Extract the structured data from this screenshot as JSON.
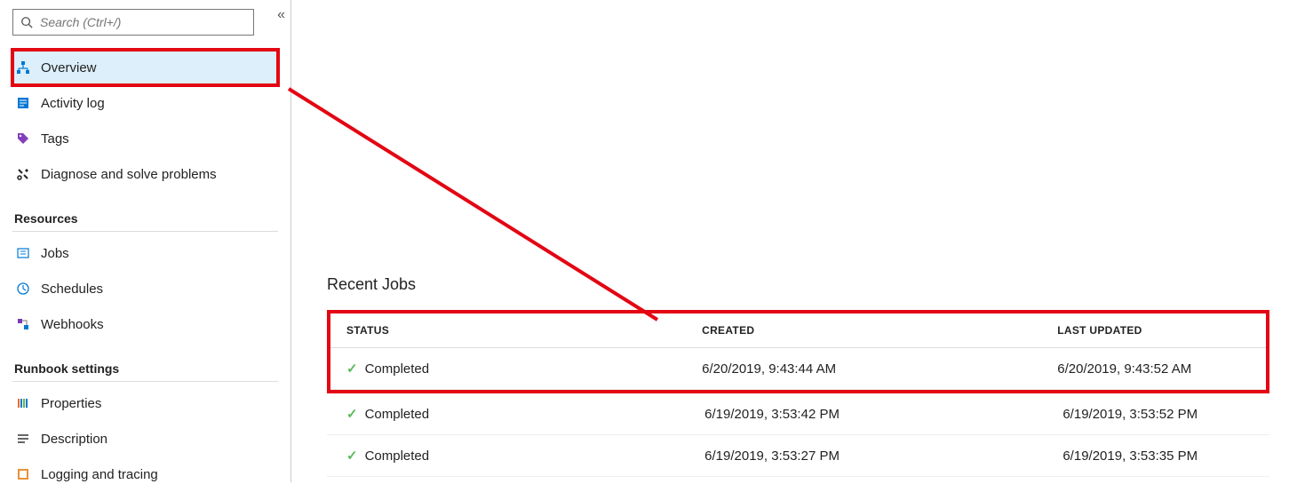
{
  "search": {
    "placeholder": "Search (Ctrl+/)"
  },
  "nav": {
    "items": [
      {
        "label": "Overview"
      },
      {
        "label": "Activity log"
      },
      {
        "label": "Tags"
      },
      {
        "label": "Diagnose and solve problems"
      }
    ],
    "resources_title": "Resources",
    "resources": [
      {
        "label": "Jobs"
      },
      {
        "label": "Schedules"
      },
      {
        "label": "Webhooks"
      }
    ],
    "runbook_title": "Runbook settings",
    "runbook": [
      {
        "label": "Properties"
      },
      {
        "label": "Description"
      },
      {
        "label": "Logging and tracing"
      }
    ]
  },
  "main": {
    "recent_title": "Recent Jobs",
    "columns": {
      "status": "STATUS",
      "created": "CREATED",
      "updated": "LAST UPDATED"
    },
    "jobs": [
      {
        "status": "Completed",
        "created": "6/20/2019, 9:43:44 AM",
        "updated": "6/20/2019, 9:43:52 AM"
      },
      {
        "status": "Completed",
        "created": "6/19/2019, 3:53:42 PM",
        "updated": "6/19/2019, 3:53:52 PM"
      },
      {
        "status": "Completed",
        "created": "6/19/2019, 3:53:27 PM",
        "updated": "6/19/2019, 3:53:35 PM"
      }
    ]
  }
}
